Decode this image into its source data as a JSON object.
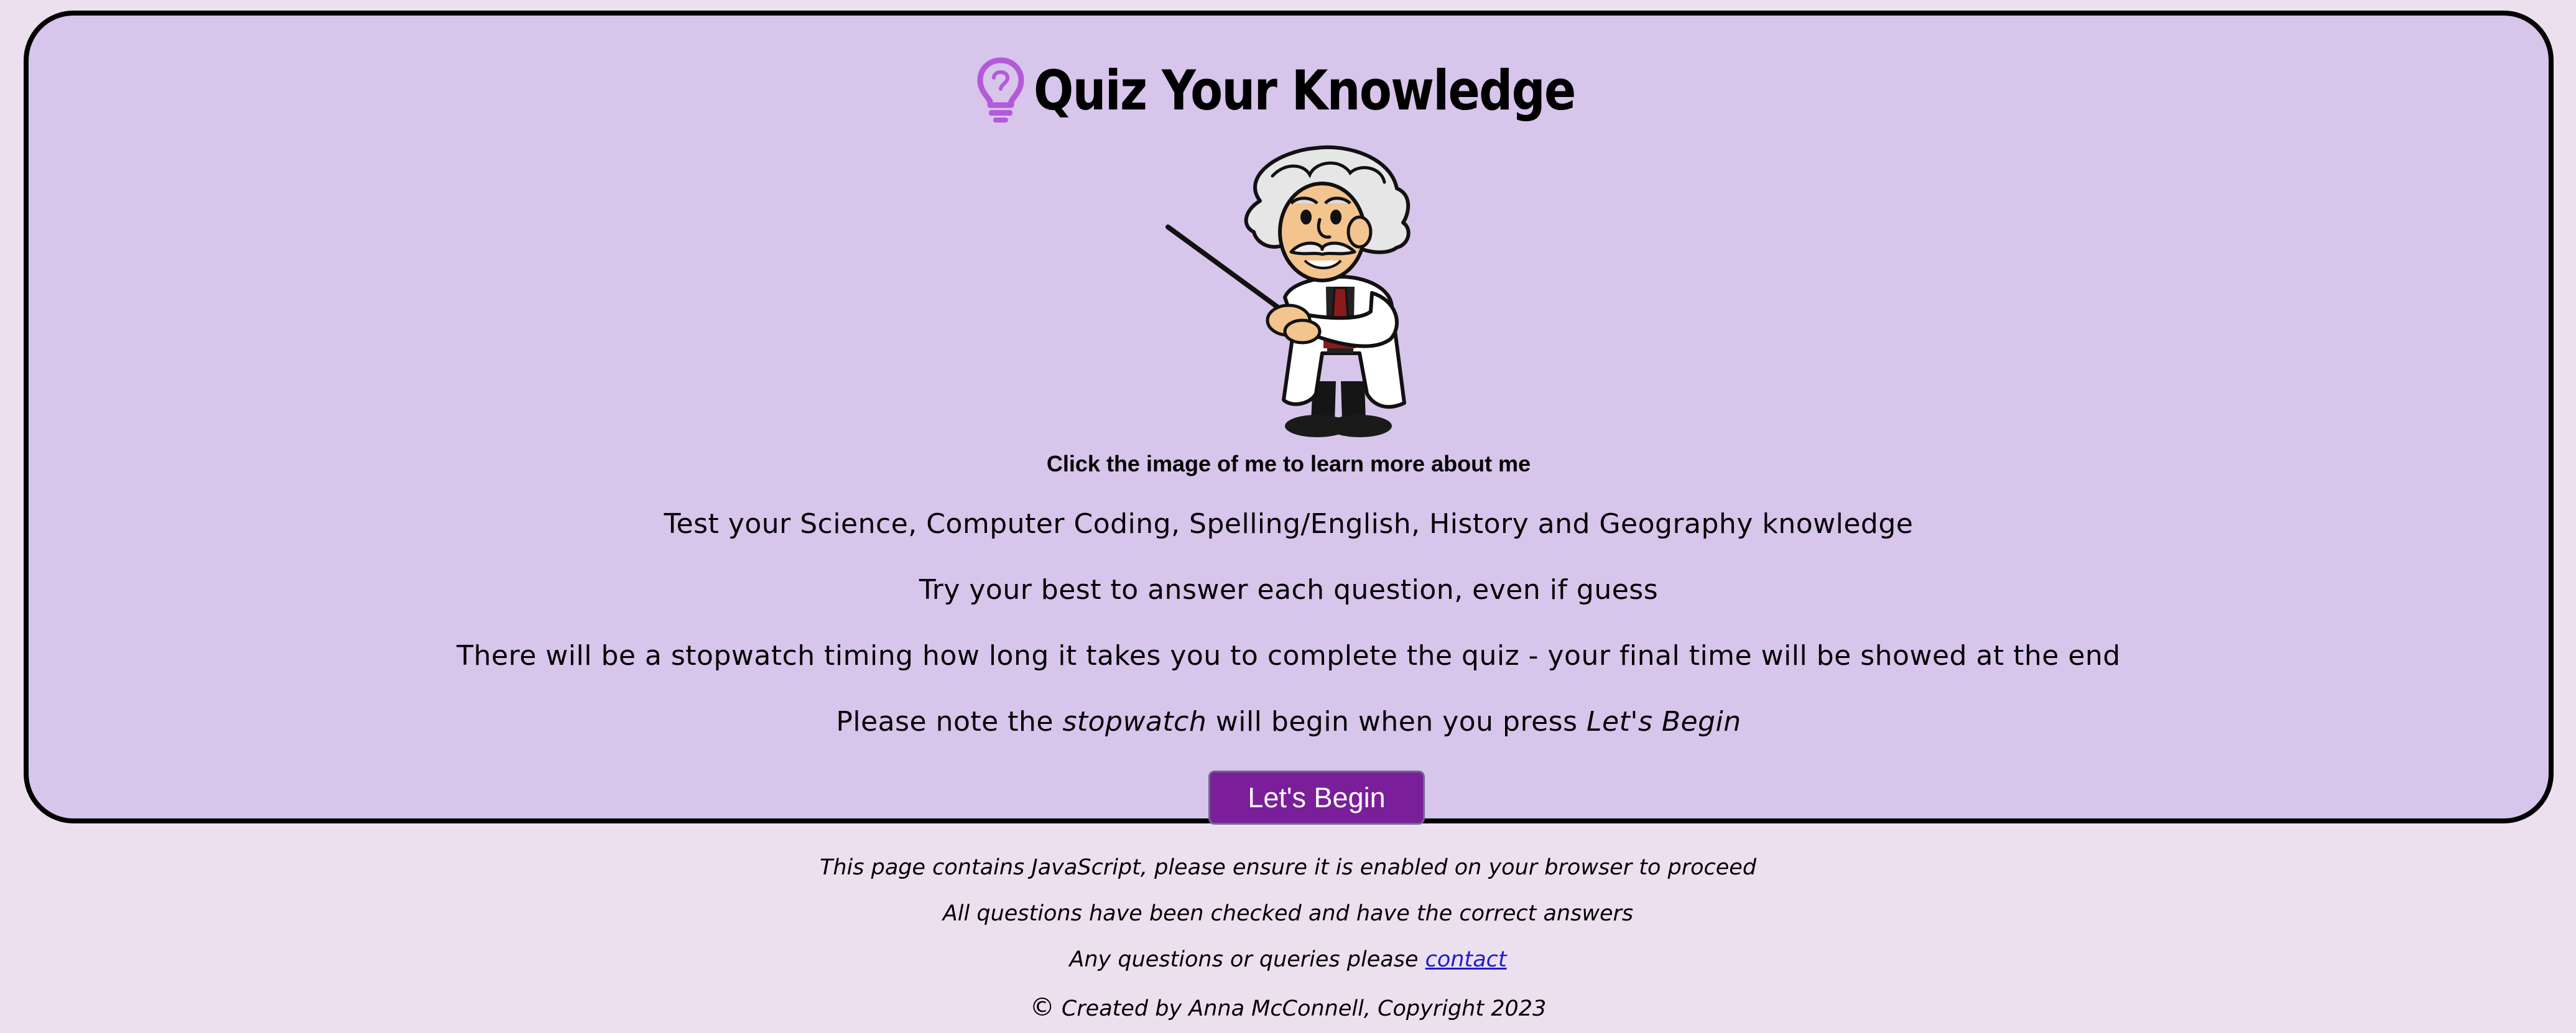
{
  "header": {
    "title": "Quiz Your Knowledge",
    "icon": "lightbulb-icon",
    "icon_color": "#b35ad8"
  },
  "mascot": {
    "caption": "Click the image of me to learn more about me"
  },
  "intro": {
    "line1": "Test your Science, Computer Coding, Spelling/English, History and Geography knowledge",
    "line2": "Try your best to answer each question, even if guess",
    "line3": "There will be a stopwatch timing how long it takes you to complete the quiz - your final time will be showed at the end",
    "line4_prefix": "Please note the ",
    "line4_stopwatch": "stopwatch",
    "line4_middle": " will begin when you press ",
    "line4_begin": "Let's Begin"
  },
  "start_button": {
    "label": "Let's Begin",
    "color": "#7b1e9a"
  },
  "footer": {
    "javascript_note": "This page contains JavaScript, please ensure it is enabled on your browser to proceed",
    "checked_note": "All questions have been checked and have the correct answers",
    "queries_prefix": "Any questions or queries please ",
    "contact_link": "contact",
    "copyright_symbol": "©",
    "copyright": " Created by Anna McConnell, Copyright 2023"
  },
  "colors": {
    "page_background": "#ede0ee",
    "card_background": "#d7c5eb",
    "link": "#1d1dcc"
  }
}
